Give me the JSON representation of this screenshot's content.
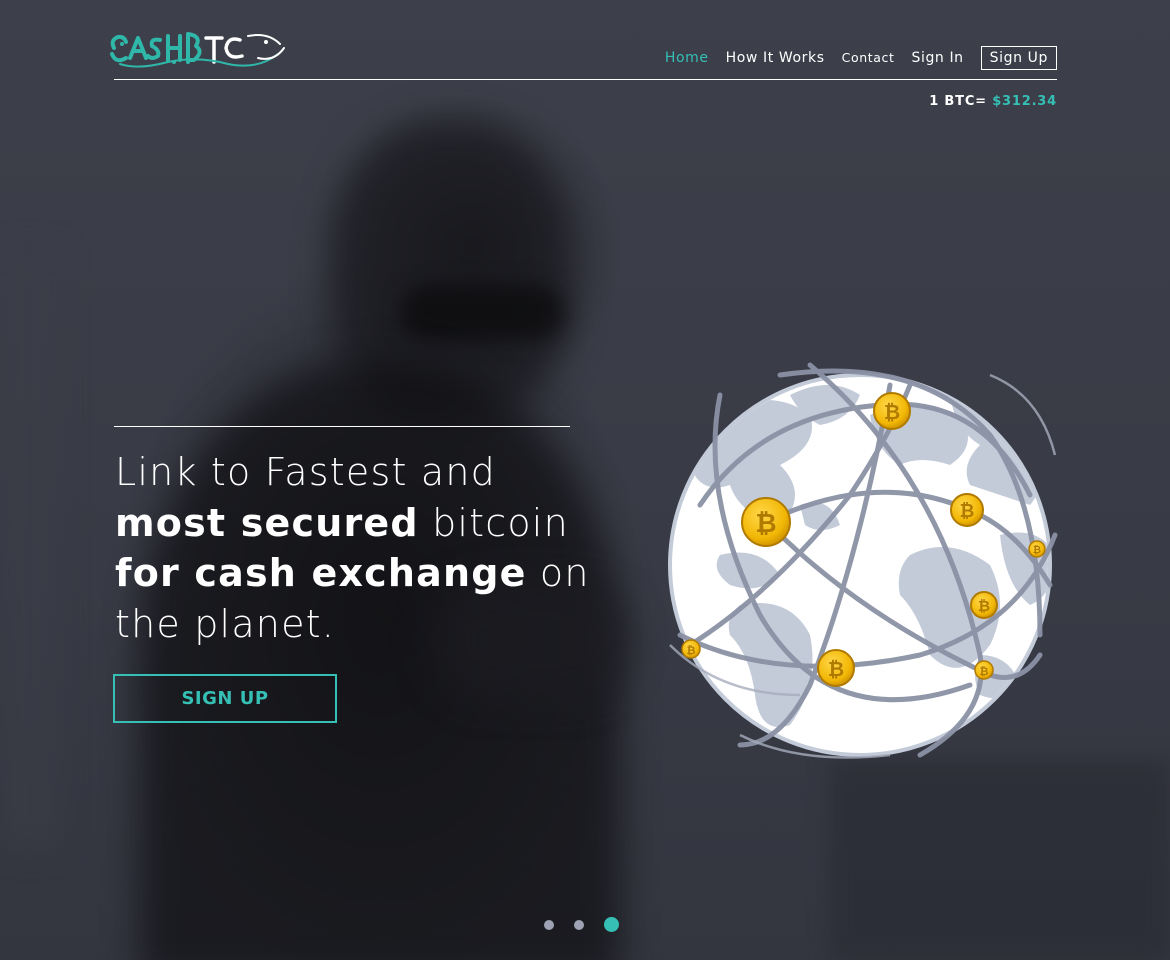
{
  "brand": {
    "logo_text": "CASHBTC",
    "logo_colors": [
      "#2fb7a9",
      "#ffffff"
    ]
  },
  "nav": {
    "items": [
      {
        "label": "Home",
        "active": true
      },
      {
        "label": "How It Works",
        "active": false
      },
      {
        "label": "Contact",
        "active": false
      },
      {
        "label": "Sign In",
        "active": false
      },
      {
        "label": "Sign Up",
        "active": false
      }
    ]
  },
  "ticker": {
    "label": "1 BTC=",
    "value": "$312.34"
  },
  "hero": {
    "line1": "Link to Fastest and",
    "line2_bold": "most secured",
    "line2_rest": " bitcoin",
    "line3_bold": "for cash exchange",
    "line3_rest": " on",
    "line4": "the planet.",
    "cta_label": "SIGN UP"
  },
  "slider": {
    "total": 3,
    "active_index": 2
  },
  "colors": {
    "accent": "#35bfb5",
    "background": "#3a3c47",
    "coin": "#f2b705",
    "globe_land": "#c3cbd9"
  },
  "icons": {
    "globe": "bitcoin-globe-illustration",
    "coin": "bitcoin-coin-icon"
  }
}
